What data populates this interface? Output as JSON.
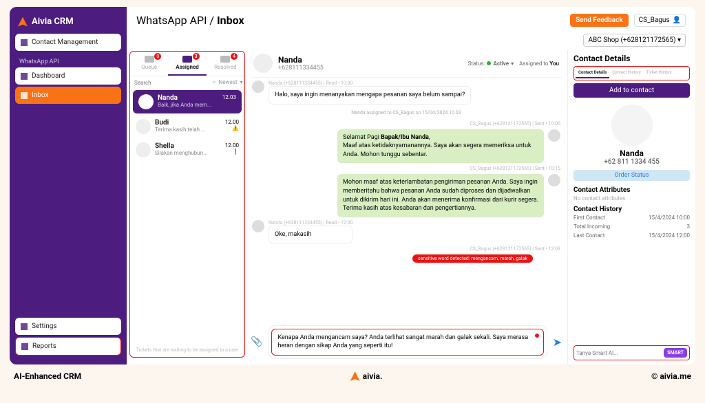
{
  "app": {
    "name": "Aivia CRM"
  },
  "sidebar": {
    "contact_mgmt": "Contact Management",
    "section_wa": "WhatsApp API",
    "dashboard": "Dashboard",
    "inbox": "Inbox",
    "settings": "Settings",
    "reports": "Reports"
  },
  "header": {
    "crumb1": "WhatsApp API / ",
    "crumb2": "Inbox",
    "feedback": "Send Feedback",
    "user": "CS_Bagus",
    "shop": "ABC Shop (+628121172565)"
  },
  "inbox": {
    "tab_queue": "Queue",
    "badge_queue": "0",
    "tab_assigned": "Assigned",
    "badge_assigned": "3",
    "tab_resolved": "Resolved",
    "badge_resolved": "4",
    "search_ph": "Search",
    "sort": "Newest",
    "footer": "Tickets that are waiting to be assigned to a user",
    "convs": [
      {
        "name": "Nanda",
        "preview": "Baik, jika Anda mem...",
        "time": "12.03",
        "active": true
      },
      {
        "name": "Budi",
        "preview": "Terima kasih telah ...",
        "time": "12.00",
        "flag": "⚠️"
      },
      {
        "name": "Shella",
        "preview": "Silakan menghubun...",
        "time": "12.00",
        "flag": "❗"
      }
    ]
  },
  "chat": {
    "name": "Nanda",
    "phone": "+628111334455",
    "status_label": "Status:",
    "status": "Active",
    "assigned_label": "Assigned to ",
    "assigned_to": "You",
    "sys": "Nanda assigned to CS_Bagus on 15/04/2024 10.03",
    "m1_meta": "Nanda (+628111334455) | Read • 10:00",
    "m1": "Halo, saya ingin menanyakan mengapa pesanan saya belum sampai?",
    "m2_meta": "CS_Bagus (+628121172565) | Sent • 10:05",
    "m2a": "Selamat Pagi ",
    "m2b": "Bapak/Ibu Nanda",
    "m2c": ",\nMaaf atas ketidaknyamanannya. Saya akan segera memeriksa untuk Anda. Mohon tunggu sebentar.",
    "m3_meta": "CS_Bagus (+628121172565) | Sent • 10:15",
    "m3": "Mohon maaf atas keterlambatan pengiriman pesanan Anda. Saya ingin memberitahu bahwa pesanan Anda sudah diproses dan dijadwalkan untuk dikirim hari ini. Anda akan menerima konfirmasi dari kurir segera. Terima kasih atas kesabaran dan pengertiannya.",
    "m4_meta": "Nanda (+628111334455) | Read • 12:00",
    "m4": "Oke, makasih",
    "m5_meta": "CS_Bagus (+628121172565) | Sent • 12:03",
    "alert": "sensitive word detected: mengancam, marah, galak",
    "m5": "Kenapa Anda mengancam saya? Anda terlihat sangat marah dan galak sekali. Saya merasa heran dengan sikap Anda yang seperti itu!"
  },
  "details": {
    "title": "Contact Details",
    "tab1": "Contact Details",
    "tab2": "Contact History",
    "tab3": "Ticket History",
    "add": "Add to contact",
    "name": "Nanda",
    "phone": "+62 811 1334 455",
    "order": "Order Status",
    "attrs_title": "Contact Attributes",
    "no_attrs": "No contact attributes",
    "history_title": "Contact History",
    "r1k": "First Contact",
    "r1v": "15/4/2024 10:00",
    "r2k": "Total Incoming",
    "r2v": "3",
    "r3k": "Last Contact",
    "r3v": "15/4/2024 12:00",
    "smart_ph": "Tanya Smart AI...",
    "smart_btn": "SMART"
  },
  "footer": {
    "tagline": "AI-Enhanced CRM",
    "brand": "aivia.",
    "copy": "© aivia.me"
  }
}
